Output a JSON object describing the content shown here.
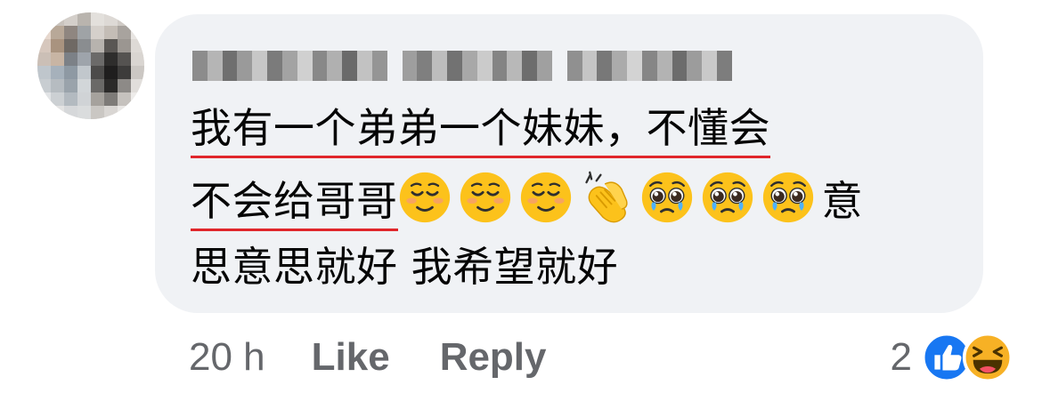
{
  "comment": {
    "author_name": "",
    "lines": [
      {
        "underlined": "我有一个弟弟一个妹妹，不懂会",
        "rest": ""
      },
      {
        "underlined": "不会给哥哥",
        "rest": "意"
      },
      {
        "underlined": "",
        "rest": "思意思就好 我希望就好"
      }
    ],
    "emojis": [
      "relieved-face-icon",
      "relieved-face-icon",
      "relieved-face-icon",
      "clapping-hands-icon",
      "pleading-face-icon",
      "pleading-face-icon",
      "pleading-face-icon"
    ]
  },
  "actions": {
    "time": "20 h",
    "like": "Like",
    "reply": "Reply"
  },
  "reactions": {
    "count": "2",
    "types": [
      "like-reaction-icon",
      "haha-reaction-icon"
    ]
  },
  "colors": {
    "bubble": "#f0f2f5",
    "underline": "#e0262b",
    "meta_text": "#65676b",
    "like_blue": "#1877f2",
    "haha_yellow": "#f7b125"
  }
}
